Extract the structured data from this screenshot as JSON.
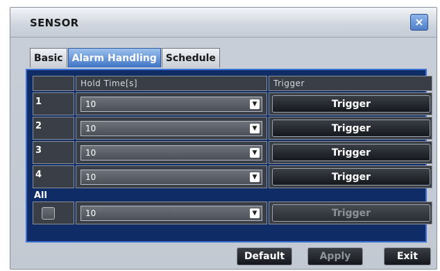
{
  "window": {
    "title": "SENSOR",
    "close_symbol": "×"
  },
  "tabs": [
    {
      "label": "Basic",
      "active": false
    },
    {
      "label": "Alarm Handling",
      "active": true
    },
    {
      "label": "Schedule",
      "active": false
    }
  ],
  "table": {
    "headers": {
      "hold_time": "Hold Time[s]",
      "trigger": "Trigger"
    },
    "rows": [
      {
        "index": "1",
        "hold_time": "10",
        "trigger_label": "Trigger"
      },
      {
        "index": "2",
        "hold_time": "10",
        "trigger_label": "Trigger"
      },
      {
        "index": "3",
        "hold_time": "10",
        "trigger_label": "Trigger"
      },
      {
        "index": "4",
        "hold_time": "10",
        "trigger_label": "Trigger"
      }
    ],
    "all": {
      "label": "All",
      "checked": false,
      "hold_time": "10",
      "trigger_label": "Trigger"
    }
  },
  "footer": {
    "default_label": "Default",
    "apply_label": "Apply",
    "exit_label": "Exit"
  },
  "colors": {
    "panel_bg": "#0f2c66",
    "active_tab": "#3f74c4",
    "cell_bg": "#3a3f47"
  },
  "icons": {
    "close": "close-icon",
    "dropdown": "chevron-down-icon"
  }
}
